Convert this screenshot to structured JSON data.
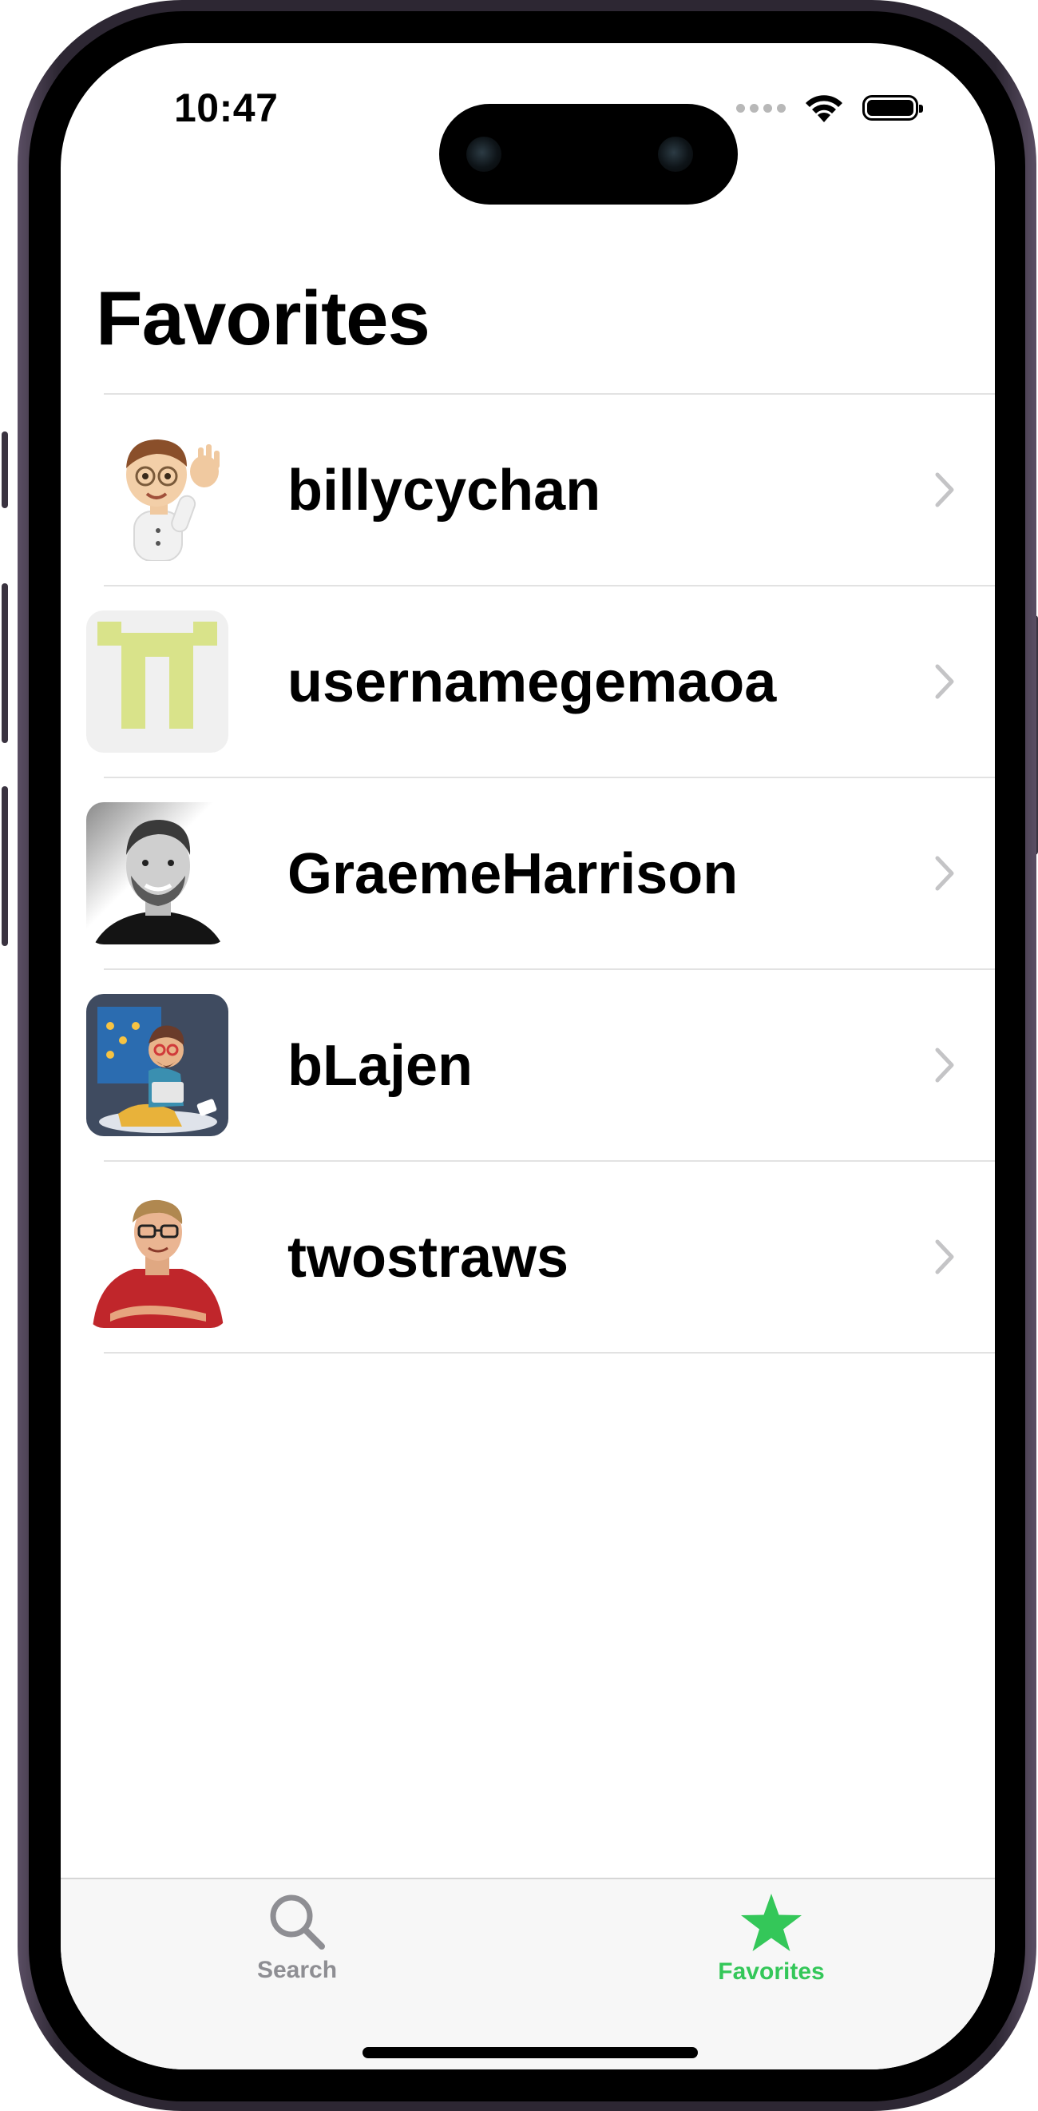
{
  "status_bar": {
    "time": "10:47"
  },
  "header": {
    "title": "Favorites"
  },
  "favorites": [
    {
      "username": "billycychan",
      "avatar": "memoji-avatar"
    },
    {
      "username": "usernamegemaoa",
      "avatar": "identicon-avatar"
    },
    {
      "username": "GraemeHarrison",
      "avatar": "photo-avatar"
    },
    {
      "username": "bLajen",
      "avatar": "cartoon-avatar"
    },
    {
      "username": "twostraws",
      "avatar": "photo-avatar"
    }
  ],
  "tab_bar": {
    "tabs": [
      {
        "label": "Search",
        "icon": "magnifying-glass-icon",
        "selected": false
      },
      {
        "label": "Favorites",
        "icon": "star-icon",
        "selected": true
      }
    ]
  },
  "colors": {
    "accent": "#34C759",
    "inactive_tab": "#8E8E93",
    "chevron": "#C4C4C6",
    "identicon": "#D9E38A"
  }
}
